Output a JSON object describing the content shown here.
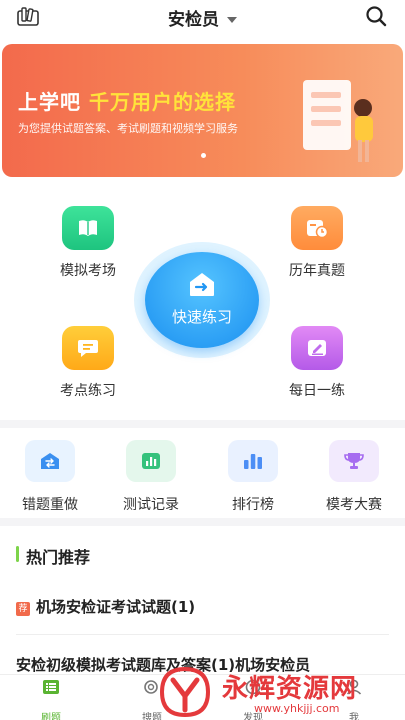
{
  "header": {
    "title": "安检员",
    "left_icon": "library-icon",
    "right_icon": "search-icon"
  },
  "banner": {
    "headline_part1": "上学吧",
    "headline_part2": "千万用户的选择",
    "subtitle": "为您提供试题答案、考试刷题和视频学习服务",
    "accent_color": "#ffe33a"
  },
  "practice": {
    "quick_label": "快速练习",
    "features": [
      {
        "label": "模拟考场",
        "icon": "book-icon"
      },
      {
        "label": "历年真题",
        "icon": "calendar-clock-icon"
      },
      {
        "label": "考点练习",
        "icon": "message-icon"
      },
      {
        "label": "每日一练",
        "icon": "edit-icon"
      }
    ]
  },
  "tools": [
    {
      "label": "错题重做",
      "icon": "redo-icon"
    },
    {
      "label": "测试记录",
      "icon": "chart-icon"
    },
    {
      "label": "排行榜",
      "icon": "ranking-icon"
    },
    {
      "label": "模考大赛",
      "icon": "trophy-icon"
    }
  ],
  "hot": {
    "title": "热门推荐",
    "tag": "荐",
    "items": [
      "机场安检证考试试题(1)",
      "安检初级模拟考试题库及答案(1)机场安检员"
    ]
  },
  "bottom_nav": [
    {
      "label": "刷题",
      "active": true
    },
    {
      "label": "搜题",
      "active": false
    },
    {
      "label": "发现",
      "active": false
    },
    {
      "label": "我",
      "active": false
    }
  ],
  "watermark": {
    "text": "永辉资源网",
    "url": "www.yhkjjj.com"
  }
}
